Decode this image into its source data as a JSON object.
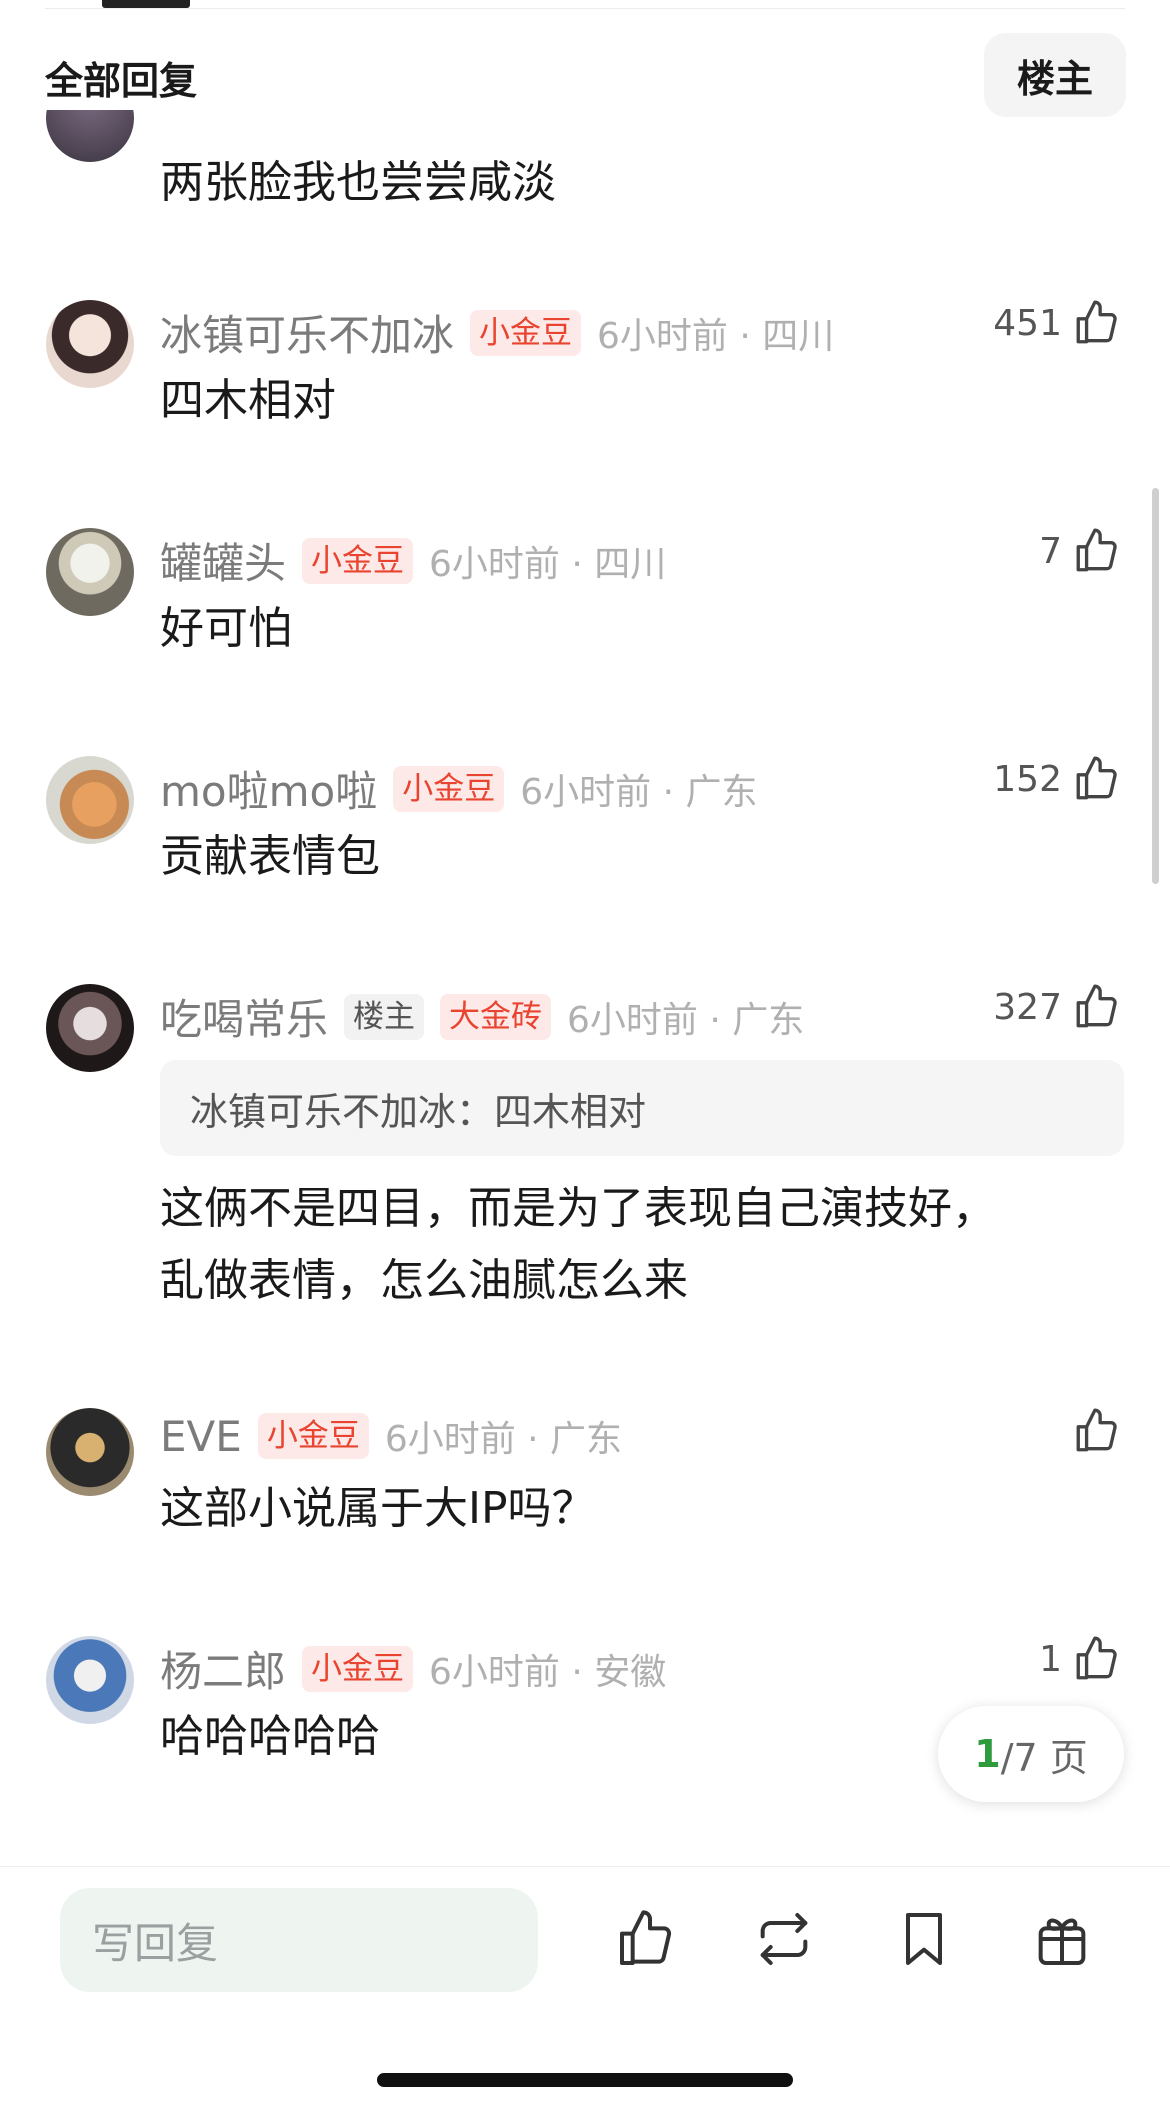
{
  "header": {
    "title": "全部回复",
    "op_button": "楼主"
  },
  "partial_comment": {
    "text": "两张脸我也尝尝咸淡"
  },
  "comments": [
    {
      "username": "冰镇可乐不加冰",
      "badges": [
        "小金豆"
      ],
      "time": "6小时前 · 四川",
      "likes": "451",
      "text": "四木相对"
    },
    {
      "username": "罐罐头",
      "badges": [
        "小金豆"
      ],
      "time": "6小时前 · 四川",
      "likes": "7",
      "text": "好可怕"
    },
    {
      "username": "mo啦mo啦",
      "badges": [
        "小金豆"
      ],
      "time": "6小时前 · 广东",
      "likes": "152",
      "text": "贡献表情包"
    },
    {
      "username": "吃喝常乐",
      "badges": [
        "楼主",
        "大金砖"
      ],
      "time": "6小时前 · 广东",
      "likes": "327",
      "quote": "冰镇可乐不加冰：四木相对",
      "text_lines": [
        "这俩不是四目，而是为了表现自己演技好，",
        "乱做表情，怎么油腻怎么来"
      ]
    },
    {
      "username": "EVE",
      "badges": [
        "小金豆"
      ],
      "time": "6小时前 · 广东",
      "likes": "",
      "text": "这部小说属于大IP吗？"
    },
    {
      "username": "杨二郎",
      "badges": [
        "小金豆"
      ],
      "time": "6小时前 · 安徽",
      "likes": "1",
      "text": "哈哈哈哈哈"
    }
  ],
  "pager": {
    "current": "1",
    "total_text": "/7 页"
  },
  "bottom_bar": {
    "reply_placeholder": "写回复",
    "icons": [
      "thumbs-up-icon",
      "repost-icon",
      "bookmark-icon",
      "gift-icon"
    ]
  },
  "colors": {
    "badge_gold": "#e84430",
    "pager_current": "#2e9b3d",
    "input_bg": "#eef5f0"
  }
}
